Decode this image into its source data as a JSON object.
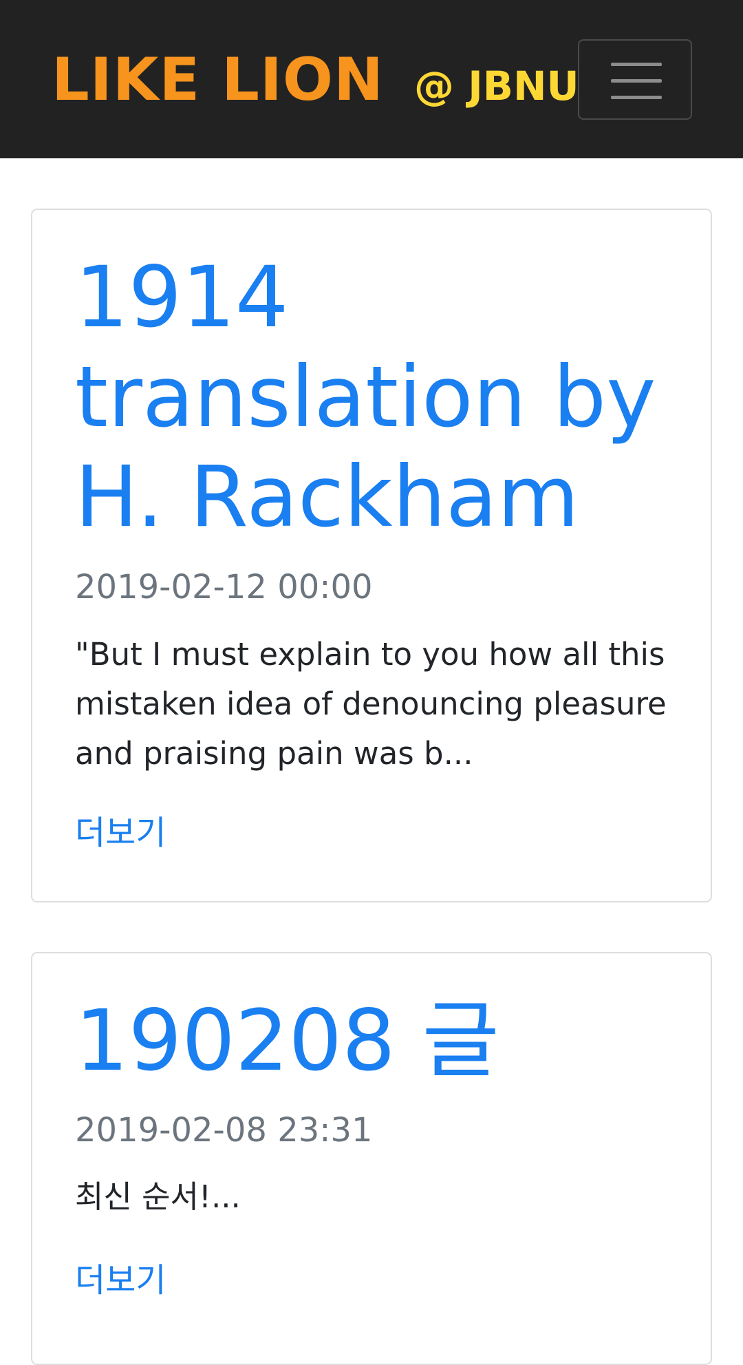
{
  "navbar": {
    "brand_main": "LIKE LION",
    "brand_sub": "@ JBNU",
    "menu_icon": "hamburger-menu-icon"
  },
  "posts": [
    {
      "title": "1914 translation by H. Rackham",
      "date": "2019-02-12 00:00",
      "excerpt": "\"But I must explain to you how all this mistaken idea of denouncing pleasure and praising pain was b...",
      "more_label": "더보기"
    },
    {
      "title": "190208 글",
      "date": "2019-02-08 23:31",
      "excerpt": "최신 순서!...",
      "more_label": "더보기"
    }
  ],
  "colors": {
    "navbar_bg": "#222222",
    "brand_main": "#f7941d",
    "brand_sub": "#fdd835",
    "link": "#1a7ff0",
    "muted": "#6c757d"
  }
}
